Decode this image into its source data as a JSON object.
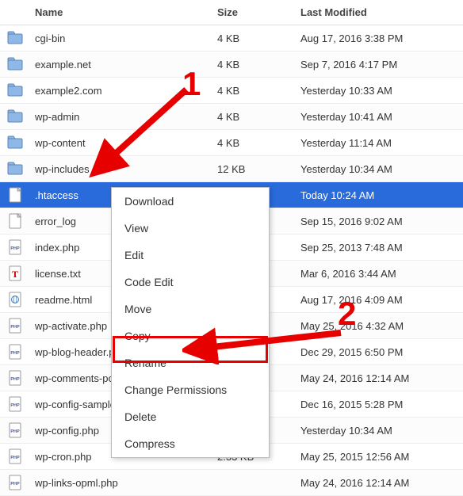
{
  "columns": {
    "name": "Name",
    "size": "Size",
    "modified": "Last Modified"
  },
  "rows": [
    {
      "icon": "folder",
      "name": "cgi-bin",
      "size": "4 KB",
      "modified": "Aug 17, 2016 3:38 PM",
      "selected": false
    },
    {
      "icon": "folder",
      "name": "example.net",
      "size": "4 KB",
      "modified": "Sep 7, 2016 4:17 PM",
      "selected": false
    },
    {
      "icon": "folder",
      "name": "example2.com",
      "size": "4 KB",
      "modified": "Yesterday 10:33 AM",
      "selected": false
    },
    {
      "icon": "folder",
      "name": "wp-admin",
      "size": "4 KB",
      "modified": "Yesterday 10:41 AM",
      "selected": false
    },
    {
      "icon": "folder",
      "name": "wp-content",
      "size": "4 KB",
      "modified": "Yesterday 11:14 AM",
      "selected": false
    },
    {
      "icon": "folder",
      "name": "wp-includes",
      "size": "12 KB",
      "modified": "Yesterday 10:34 AM",
      "selected": false
    },
    {
      "icon": "file",
      "name": ".htaccess",
      "size": "",
      "modified": "Today 10:24 AM",
      "selected": true
    },
    {
      "icon": "file",
      "name": "error_log",
      "size": "",
      "modified": "Sep 15, 2016 9:02 AM",
      "selected": false
    },
    {
      "icon": "php",
      "name": "index.php",
      "size": "",
      "modified": "Sep 25, 2013 7:48 AM",
      "selected": false
    },
    {
      "icon": "text",
      "name": "license.txt",
      "size": "",
      "modified": "Mar 6, 2016 3:44 AM",
      "selected": false
    },
    {
      "icon": "html",
      "name": "readme.html",
      "size": "",
      "modified": "Aug 17, 2016 4:09 AM",
      "selected": false
    },
    {
      "icon": "php",
      "name": "wp-activate.php",
      "size": "",
      "modified": "May 25, 2016 4:32 AM",
      "selected": false
    },
    {
      "icon": "php",
      "name": "wp-blog-header.php",
      "size": "",
      "modified": "Dec 29, 2015 6:50 PM",
      "selected": false
    },
    {
      "icon": "php",
      "name": "wp-comments-post.php",
      "size": "",
      "modified": "May 24, 2016 12:14 AM",
      "selected": false
    },
    {
      "icon": "php",
      "name": "wp-config-sample.php",
      "size": "",
      "modified": "Dec 16, 2015 5:28 PM",
      "selected": false
    },
    {
      "icon": "php",
      "name": "wp-config.php",
      "size": "",
      "modified": "Yesterday 10:34 AM",
      "selected": false
    },
    {
      "icon": "php",
      "name": "wp-cron.php",
      "size": "2.33 KB",
      "modified": "May 25, 2015 12:56 AM",
      "selected": false
    },
    {
      "icon": "php",
      "name": "wp-links-opml.php",
      "size": "",
      "modified": "May 24, 2016 12:14 AM",
      "selected": false
    }
  ],
  "context_menu": {
    "items": [
      {
        "label": "Download"
      },
      {
        "label": "View"
      },
      {
        "label": "Edit"
      },
      {
        "label": "Code Edit"
      },
      {
        "label": "Move"
      },
      {
        "label": "Copy"
      },
      {
        "label": "Rename"
      },
      {
        "label": "Change Permissions"
      },
      {
        "label": "Delete"
      },
      {
        "label": "Compress"
      }
    ]
  },
  "annotations": {
    "label1": "1",
    "label2": "2"
  }
}
